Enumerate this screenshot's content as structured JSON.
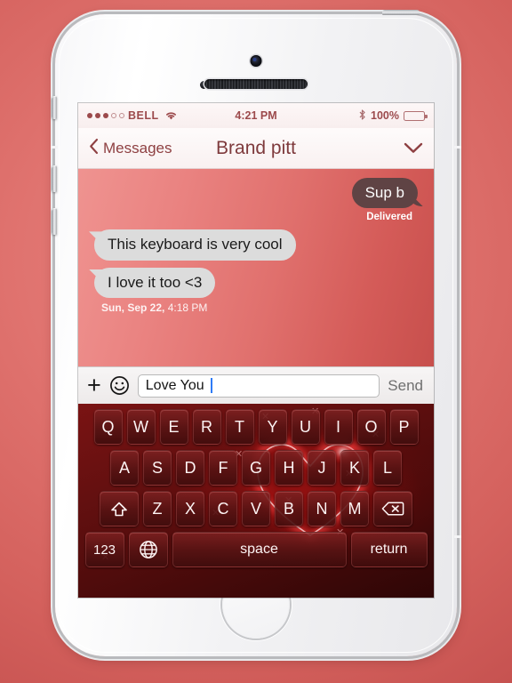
{
  "device": {
    "name": "white-iphone-5s",
    "hardware": {
      "camera": "front-camera",
      "sensor": "proximity-sensor",
      "speaker": "earpiece-speaker",
      "home_button": "home-button",
      "power_button": "power-button",
      "silence_switch": "silence-switch",
      "volume_up": "volume-up-button",
      "volume_down": "volume-down-button"
    }
  },
  "colors": {
    "backdrop": "#e0736f",
    "keyboard_base": "#4c0b0b",
    "key_face": "#58 1414",
    "accent_red": "#9c4a4c",
    "sent_bubble": "#5f4344",
    "received_bubble": "#dcdcdc",
    "caret_blue": "#2f7bf6"
  },
  "status_bar": {
    "signal_dots": {
      "filled": 3,
      "hollow": 2
    },
    "carrier": "BELL",
    "wifi_icon": "wifi-icon",
    "time": "4:21 PM",
    "bluetooth_icon": "bluetooth-icon",
    "battery_percent": "100%",
    "battery_level": 100
  },
  "nav_bar": {
    "back_icon": "chevron-left-icon",
    "back_label": "Messages",
    "title": "Brand pitt",
    "details_icon": "chevron-down-icon"
  },
  "chat": {
    "messages": [
      {
        "id": "m1",
        "side": "sent",
        "text": "Sup b"
      },
      {
        "id": "m2",
        "side": "received",
        "text": "This keyboard is very cool"
      },
      {
        "id": "m3",
        "side": "received",
        "text": "I love it too <3"
      }
    ],
    "delivered_label": "Delivered",
    "timestamp_day": "Sun, Sep 22,",
    "timestamp_time": " 4:18 PM"
  },
  "input_bar": {
    "plus_icon": "plus-icon",
    "plus_glyph": "+",
    "emoji_icon": "smiley-icon",
    "value": "Love You",
    "placeholder": "",
    "send_label": "Send"
  },
  "keyboard": {
    "theme": "glowing-red-heart",
    "rows": [
      {
        "id": "row-1",
        "keys": [
          "Q",
          "W",
          "E",
          "R",
          "T",
          "Y",
          "U",
          "I",
          "O",
          "P"
        ]
      },
      {
        "id": "row-2",
        "keys": [
          "A",
          "S",
          "D",
          "F",
          "G",
          "H",
          "J",
          "K",
          "L"
        ]
      },
      {
        "id": "row-3",
        "keys": [
          "Z",
          "X",
          "C",
          "V",
          "B",
          "N",
          "M"
        ]
      }
    ],
    "shift_key": {
      "name": "shift-key",
      "icon": "shift-arrow-icon"
    },
    "backspace_key": {
      "name": "backspace-key",
      "icon": "backspace-icon"
    },
    "numeric_key": {
      "name": "numeric-key",
      "label": "123"
    },
    "globe_key": {
      "name": "globe-key",
      "icon": "globe-icon"
    },
    "space_key": {
      "name": "space-key",
      "label": "space"
    },
    "return_key": {
      "name": "return-key",
      "label": "return"
    }
  }
}
